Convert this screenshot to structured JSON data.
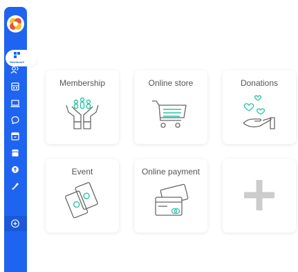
{
  "sidebar": {
    "active_label": "Dashboard",
    "items": [
      {
        "icon": "users-icon"
      },
      {
        "icon": "calculator-icon"
      },
      {
        "icon": "laptop-icon"
      },
      {
        "icon": "chat-icon"
      },
      {
        "icon": "archive-icon"
      },
      {
        "icon": "store-icon"
      },
      {
        "icon": "donation-icon"
      },
      {
        "icon": "rocket-icon"
      },
      {
        "icon": "add-circle-icon"
      }
    ]
  },
  "cards": [
    {
      "title": "Membership",
      "icon": "membership-hands-icon"
    },
    {
      "title": "Online store",
      "icon": "shopping-cart-icon"
    },
    {
      "title": "Donations",
      "icon": "hearts-hand-icon"
    },
    {
      "title": "Event",
      "icon": "tickets-icon"
    },
    {
      "title": "Online payment",
      "icon": "credit-cards-icon"
    },
    {
      "title": "",
      "icon": "plus-icon"
    }
  ],
  "colors": {
    "accent": "#1f64f0",
    "teal": "#2bc3a4",
    "line": "#666666",
    "plus": "#cccccc"
  }
}
